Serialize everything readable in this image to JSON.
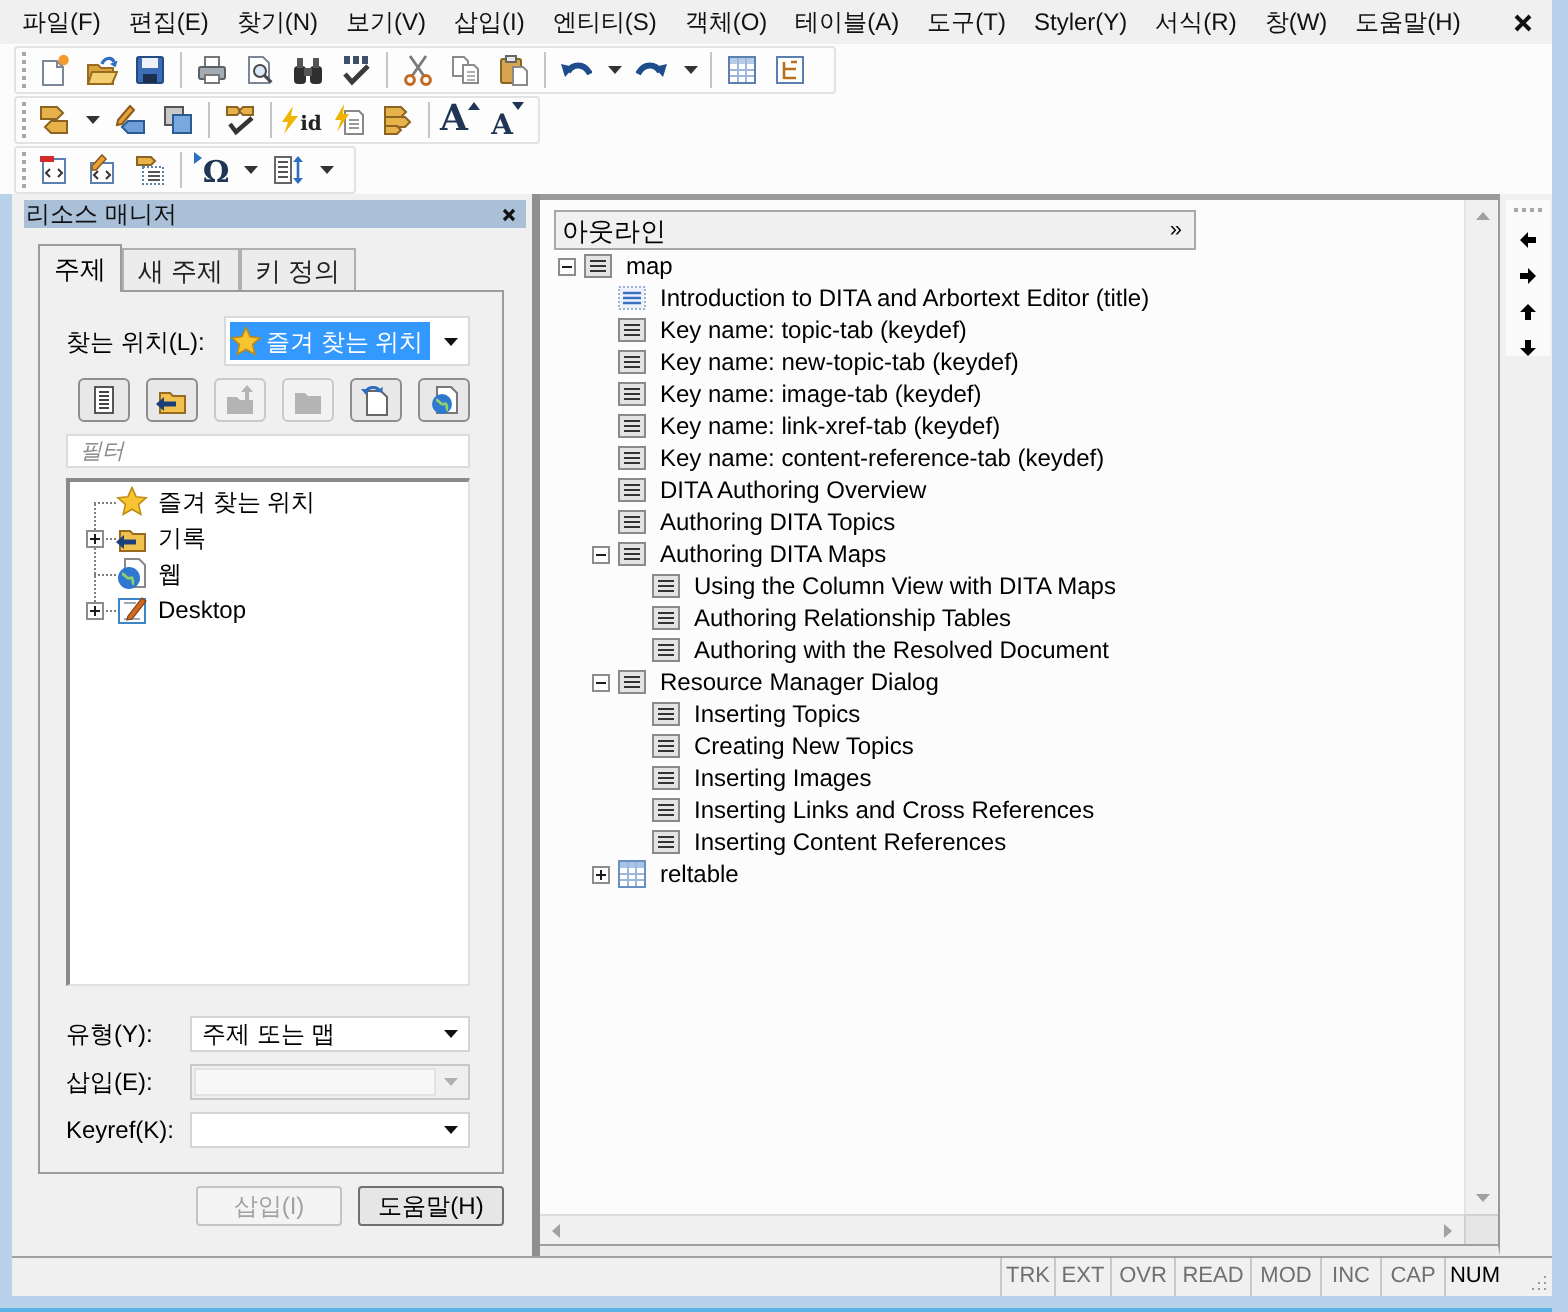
{
  "menu_bar": {
    "items": [
      "파일(F)",
      "편집(E)",
      "찾기(N)",
      "보기(V)",
      "삽입(I)",
      "엔티티(S)",
      "객체(O)",
      "테이블(A)",
      "도구(T)",
      "Styler(Y)",
      "서식(R)",
      "창(W)",
      "도움말(H)"
    ]
  },
  "toolbar_texts": [
    "id",
    "A",
    "A",
    "Ω"
  ],
  "resource_manager": {
    "title": "리소스 매니저",
    "tabs": [
      {
        "label": "주제",
        "selected": true
      },
      {
        "label": "새 주제",
        "selected": false
      },
      {
        "label": "키 정의",
        "selected": false
      }
    ],
    "look_in": {
      "label": "찾는 위치(L):",
      "value": "즐겨 찾는 위치"
    },
    "location_buttons": [
      {
        "disabled": false
      },
      {
        "disabled": false
      },
      {
        "disabled": true
      },
      {
        "disabled": true
      },
      {
        "disabled": false
      },
      {
        "disabled": false
      }
    ],
    "filter": {
      "placeholder": "필터"
    },
    "locations": [
      {
        "label": "즐겨 찾는 위치",
        "kind": "favorites"
      },
      {
        "label": "기록",
        "kind": "history",
        "expanded": false
      },
      {
        "label": "웹",
        "kind": "web"
      },
      {
        "label": "Desktop",
        "kind": "desktop",
        "expanded": false
      }
    ],
    "fields": [
      {
        "label": "유형(Y):",
        "value": "주제 또는 맵",
        "disabled": false
      },
      {
        "label": "삽입(E):",
        "disabled": true
      },
      {
        "label": "Keyref(K):",
        "disabled": false
      }
    ],
    "buttons": [
      {
        "label": "삽입(I)",
        "disabled": true
      },
      {
        "label": "도움말(H)",
        "disabled": false
      }
    ]
  },
  "outline": {
    "title": "아웃라인",
    "more": "»",
    "nodes": [
      {
        "label": "map",
        "kind": "map",
        "expanded": true,
        "children": [
          {
            "label": "Introduction to DITA and Arbortext Editor (title)",
            "kind": "title"
          },
          {
            "label": "Key name: topic-tab (keydef)",
            "kind": "topicref"
          },
          {
            "label": "Key name: new-topic-tab (keydef)",
            "kind": "topicref"
          },
          {
            "label": "Key name: image-tab (keydef)",
            "kind": "topicref"
          },
          {
            "label": "Key name: link-xref-tab (keydef)",
            "kind": "topicref"
          },
          {
            "label": "Key name: content-reference-tab (keydef)",
            "kind": "topicref"
          },
          {
            "label": "DITA Authoring Overview",
            "kind": "topicref"
          },
          {
            "label": "Authoring DITA Topics",
            "kind": "topicref"
          },
          {
            "label": "Authoring DITA Maps",
            "kind": "topicref",
            "expanded": true,
            "children": [
              {
                "label": "Using the Column View with DITA Maps",
                "kind": "topicref"
              },
              {
                "label": "Authoring Relationship Tables",
                "kind": "topicref"
              },
              {
                "label": "Authoring with the Resolved Document",
                "kind": "topicref"
              }
            ]
          },
          {
            "label": "Resource Manager Dialog",
            "kind": "topicref",
            "expanded": true,
            "children": [
              {
                "label": "Inserting Topics",
                "kind": "topicref"
              },
              {
                "label": "Creating New Topics",
                "kind": "topicref"
              },
              {
                "label": "Inserting Images",
                "kind": "topicref"
              },
              {
                "label": "Inserting Links and Cross References",
                "kind": "topicref"
              },
              {
                "label": "Inserting Content References",
                "kind": "topicref"
              }
            ]
          },
          {
            "label": "reltable",
            "kind": "reltable",
            "expanded": false
          }
        ]
      }
    ]
  },
  "status_bar": {
    "indicators": [
      {
        "label": "TRK",
        "on": false
      },
      {
        "label": "EXT",
        "on": false
      },
      {
        "label": "OVR",
        "on": false
      },
      {
        "label": "READ",
        "on": false
      },
      {
        "label": "MOD",
        "on": false
      },
      {
        "label": "INC",
        "on": false
      },
      {
        "label": "CAP",
        "on": false
      },
      {
        "label": "NUM",
        "on": true
      }
    ]
  }
}
